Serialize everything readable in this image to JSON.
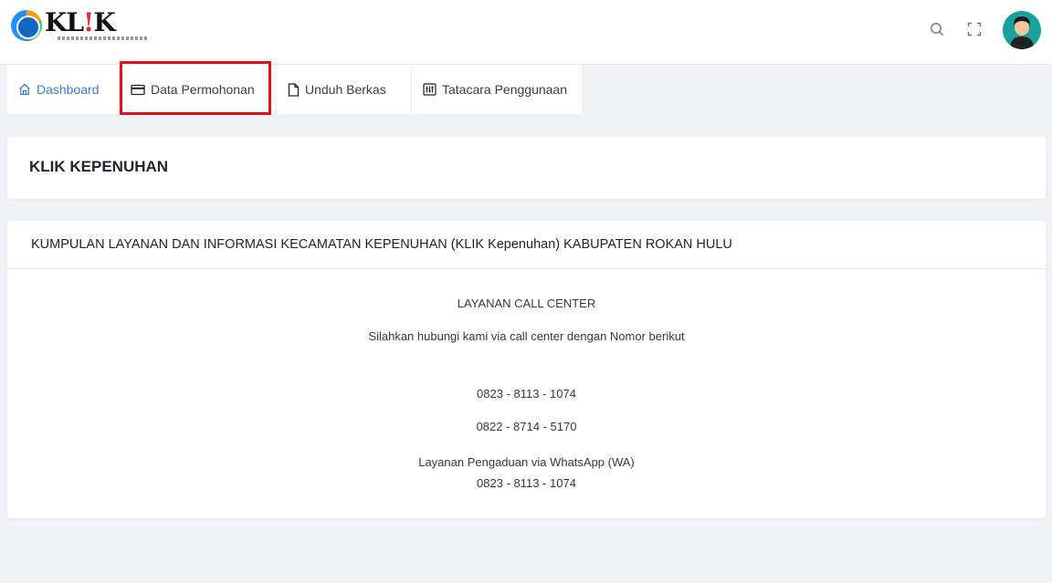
{
  "header": {
    "logo_text_main": "KL",
    "logo_text_bang": "!",
    "logo_text_end": "K",
    "icons": [
      "search-icon",
      "fullscreen-icon",
      "user-avatar"
    ]
  },
  "nav": {
    "tabs": [
      {
        "label": "Dashboard",
        "icon": "home-icon"
      },
      {
        "label": "Data Permohonan",
        "icon": "card-icon"
      },
      {
        "label": "Unduh Berkas",
        "icon": "file-icon"
      },
      {
        "label": "Tatacara Penggunaan",
        "icon": "manual-icon"
      }
    ],
    "active_color": "#3b7ddd",
    "highlight_color": "#e0101a"
  },
  "main": {
    "page_title": "KLIK KEPENUHAN",
    "info_card": {
      "header": "KUMPULAN LAYANAN DAN INFORMASI KECAMATAN KEPENUHAN (KLIK Kepenuhan) KABUPATEN ROKAN HULU",
      "call_center_title": "LAYANAN CALL CENTER",
      "call_center_desc": "Silahkan hubungi kami via call center dengan Nomor berikut",
      "phone_1": "0823 - 8113 - 1074",
      "phone_2": "0822 - 8714 - 5170",
      "wa_title": "Layanan Pengaduan via WhatsApp (WA)",
      "wa_phone": "0823 - 8113 - 1074"
    }
  }
}
